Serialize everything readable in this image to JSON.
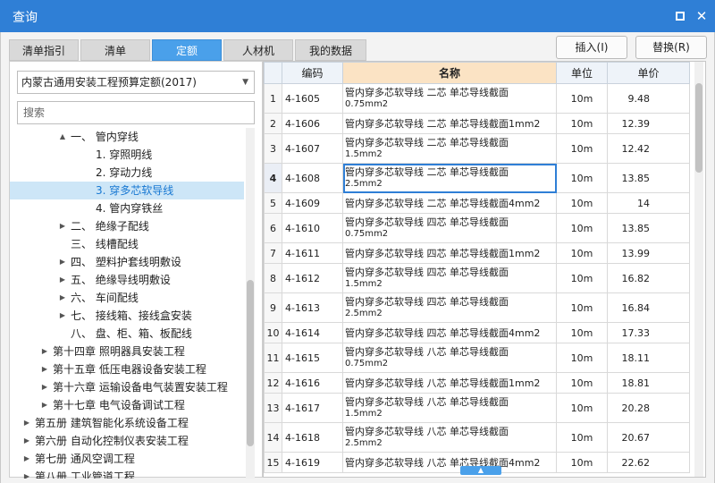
{
  "window": {
    "title": "查询"
  },
  "tabs": [
    "清单指引",
    "清单",
    "定额",
    "人材机",
    "我的数据"
  ],
  "active_tab": "定额",
  "actions": {
    "insert": "插入(I)",
    "replace": "替换(R)"
  },
  "left": {
    "selected_library": "内蒙古通用安装工程预算定额(2017)",
    "search_placeholder": "搜索",
    "tree": [
      {
        "label": "一、 管内穿线",
        "arrow": "▲"
      },
      {
        "label": "1. 穿照明线",
        "arrow": ""
      },
      {
        "label": "2. 穿动力线",
        "arrow": ""
      },
      {
        "label": "3. 穿多芯软导线",
        "arrow": ""
      },
      {
        "label": "4. 管内穿铁丝",
        "arrow": ""
      },
      {
        "label": "二、 绝缘子配线",
        "arrow": "▶"
      },
      {
        "label": "三、 线槽配线",
        "arrow": ""
      },
      {
        "label": "四、 塑料护套线明敷设",
        "arrow": "▶"
      },
      {
        "label": "五、 绝缘导线明敷设",
        "arrow": "▶"
      },
      {
        "label": "六、 车间配线",
        "arrow": "▶"
      },
      {
        "label": "七、 接线箱、接线盒安装",
        "arrow": "▶"
      },
      {
        "label": "八、 盘、柜、箱、板配线",
        "arrow": ""
      },
      {
        "label": "第十四章 照明器具安装工程",
        "arrow": "▶"
      },
      {
        "label": "第十五章 低压电器设备安装工程",
        "arrow": "▶"
      },
      {
        "label": "第十六章 运输设备电气装置安装工程",
        "arrow": "▶"
      },
      {
        "label": "第十七章 电气设备调试工程",
        "arrow": "▶"
      },
      {
        "label": "第五册 建筑智能化系统设备工程",
        "arrow": "▶"
      },
      {
        "label": "第六册 自动化控制仪表安装工程",
        "arrow": "▶"
      },
      {
        "label": "第七册 通风空调工程",
        "arrow": "▶"
      },
      {
        "label": "第八册 工业管道工程",
        "arrow": "▶"
      }
    ]
  },
  "table": {
    "headers": {
      "code": "编码",
      "name": "名称",
      "unit": "单位",
      "price": "单价"
    },
    "rows": [
      {
        "no": "1",
        "code": "4-1605",
        "name1": "管内穿多芯软导线 二芯 单芯导线截面",
        "name2": "0.75mm2",
        "unit": "10m",
        "price": "9.48"
      },
      {
        "no": "2",
        "code": "4-1606",
        "name1": "管内穿多芯软导线 二芯 单芯导线截面1mm2",
        "name2": "",
        "unit": "10m",
        "price": "12.39"
      },
      {
        "no": "3",
        "code": "4-1607",
        "name1": "管内穿多芯软导线 二芯 单芯导线截面",
        "name2": "1.5mm2",
        "unit": "10m",
        "price": "12.42"
      },
      {
        "no": "4",
        "code": "4-1608",
        "name1": "管内穿多芯软导线 二芯 单芯导线截面",
        "name2": "2.5mm2",
        "unit": "10m",
        "price": "13.85"
      },
      {
        "no": "5",
        "code": "4-1609",
        "name1": "管内穿多芯软导线 二芯 单芯导线截面4mm2",
        "name2": "",
        "unit": "10m",
        "price": "14"
      },
      {
        "no": "6",
        "code": "4-1610",
        "name1": "管内穿多芯软导线 四芯 单芯导线截面",
        "name2": "0.75mm2",
        "unit": "10m",
        "price": "13.85"
      },
      {
        "no": "7",
        "code": "4-1611",
        "name1": "管内穿多芯软导线 四芯 单芯导线截面1mm2",
        "name2": "",
        "unit": "10m",
        "price": "13.99"
      },
      {
        "no": "8",
        "code": "4-1612",
        "name1": "管内穿多芯软导线 四芯 单芯导线截面",
        "name2": "1.5mm2",
        "unit": "10m",
        "price": "16.82"
      },
      {
        "no": "9",
        "code": "4-1613",
        "name1": "管内穿多芯软导线 四芯 单芯导线截面",
        "name2": "2.5mm2",
        "unit": "10m",
        "price": "16.84"
      },
      {
        "no": "10",
        "code": "4-1614",
        "name1": "管内穿多芯软导线 四芯 单芯导线截面4mm2",
        "name2": "",
        "unit": "10m",
        "price": "17.33"
      },
      {
        "no": "11",
        "code": "4-1615",
        "name1": "管内穿多芯软导线 八芯 单芯导线截面",
        "name2": "0.75mm2",
        "unit": "10m",
        "price": "18.11"
      },
      {
        "no": "12",
        "code": "4-1616",
        "name1": "管内穿多芯软导线 八芯 单芯导线截面1mm2",
        "name2": "",
        "unit": "10m",
        "price": "18.81"
      },
      {
        "no": "13",
        "code": "4-1617",
        "name1": "管内穿多芯软导线 八芯 单芯导线截面",
        "name2": "1.5mm2",
        "unit": "10m",
        "price": "20.28"
      },
      {
        "no": "14",
        "code": "4-1618",
        "name1": "管内穿多芯软导线 八芯 单芯导线截面",
        "name2": "2.5mm2",
        "unit": "10m",
        "price": "20.67"
      },
      {
        "no": "15",
        "code": "4-1619",
        "name1": "管内穿多芯软导线 八芯 单芯导线截面4mm2",
        "name2": "",
        "unit": "10m",
        "price": "22.62"
      }
    ]
  },
  "selected_tree_item": "3. 穿多芯软导线",
  "selected_row": "4",
  "colors": {
    "title_bar": "#2f7fd6",
    "active_tab": "#4aa0ea",
    "selected_tree": "#cde6f7",
    "name_header": "#fbe3c4"
  }
}
